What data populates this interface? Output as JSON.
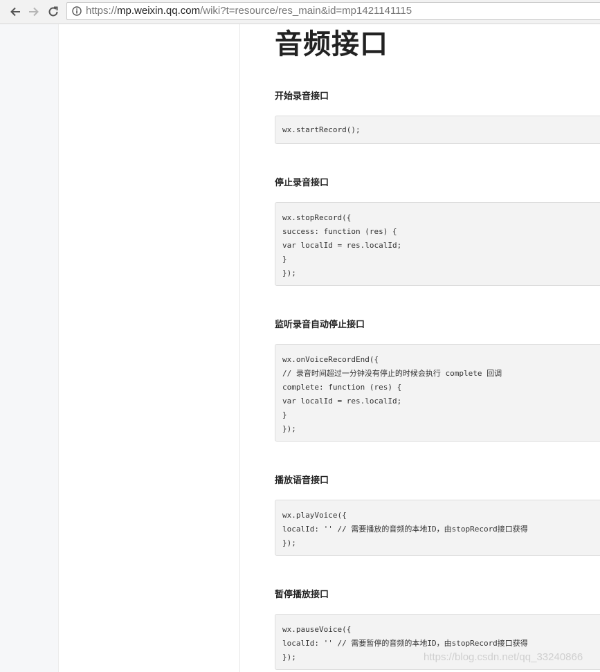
{
  "browser": {
    "url_scheme": "https://",
    "url_host": "mp.weixin.qq.com",
    "url_path": "/wiki?t=resource/res_main&id=mp1421141115"
  },
  "page": {
    "title": "音频接口"
  },
  "sections": [
    {
      "title": "开始录音接口",
      "code": [
        "wx.startRecord();"
      ]
    },
    {
      "title": "停止录音接口",
      "code": [
        "wx.stopRecord({",
        "success: function (res) {",
        "var localId = res.localId;",
        "}",
        "});"
      ]
    },
    {
      "title": "监听录音自动停止接口",
      "code": [
        "wx.onVoiceRecordEnd({",
        "// 录音时间超过一分钟没有停止的时候会执行 complete 回调",
        "complete: function (res) {",
        "var localId = res.localId;",
        "}",
        "});"
      ]
    },
    {
      "title": "播放语音接口",
      "code": [
        "wx.playVoice({",
        "localId: '' // 需要播放的音频的本地ID，由stopRecord接口获得",
        "});"
      ]
    },
    {
      "title": "暂停播放接口",
      "code": [
        "wx.pauseVoice({",
        "localId: '' // 需要暂停的音频的本地ID，由stopRecord接口获得",
        "});"
      ]
    }
  ],
  "watermark": "https://blog.csdn.net/qq_33240866",
  "colors": {
    "code_bg": "#f3f3f3",
    "code_border": "#dcdcdc",
    "gutter_bg": "#f6f7f9"
  }
}
